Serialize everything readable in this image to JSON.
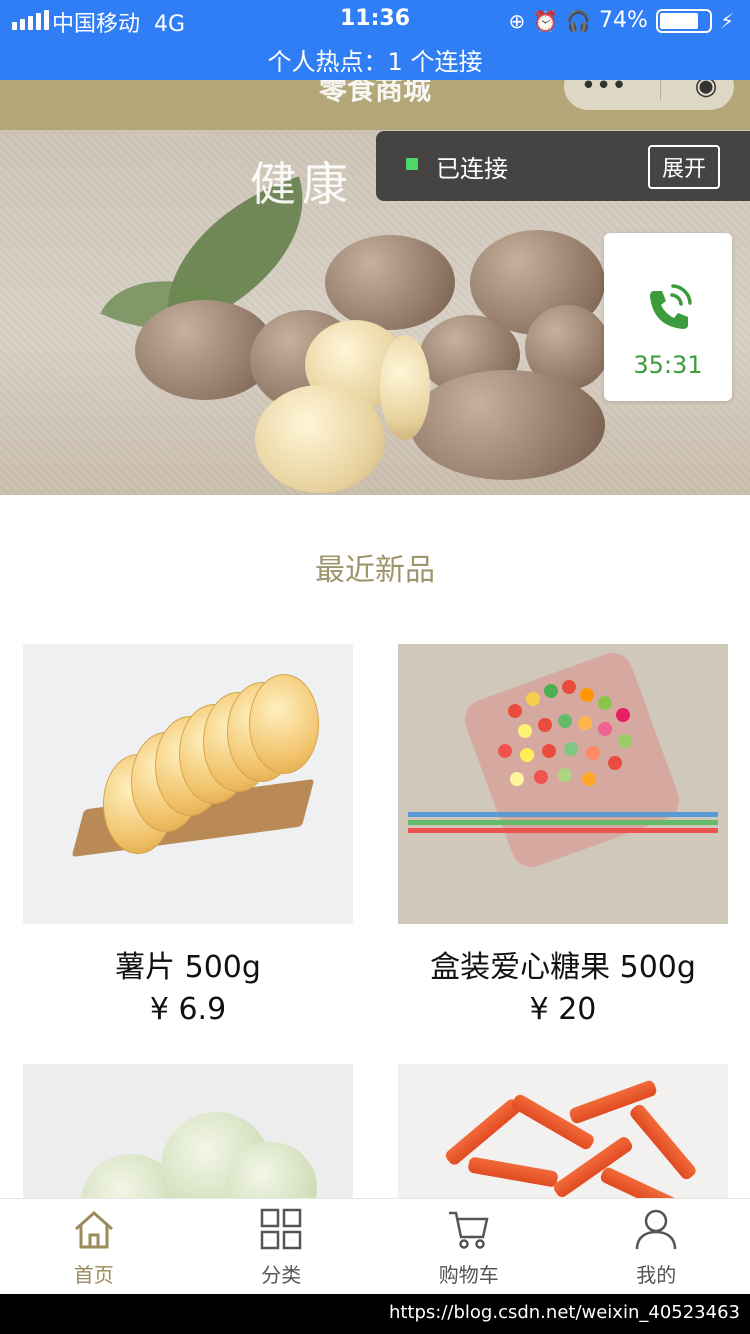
{
  "status_bar": {
    "carrier": "中国移动",
    "network": "4G",
    "time": "11:36",
    "battery_percent": "74%",
    "hotspot_text": "个人热点：1 个连接",
    "icons": [
      "signal-icon",
      "lock-rotation-icon",
      "alarm-icon",
      "headphones-icon",
      "battery-icon",
      "charging-icon"
    ],
    "bar_color": "#2f7ef6"
  },
  "mini_program": {
    "title": "零食商城",
    "capsule_icons": [
      "more-icon",
      "close-icon"
    ]
  },
  "hero": {
    "decor_text": "健康"
  },
  "overlay": {
    "connected_text": "已连接",
    "expand_label": "展开"
  },
  "call_widget": {
    "icon": "phone-call-icon",
    "duration": "35:31",
    "color": "#3c9b3c"
  },
  "section": {
    "title": "最近新品",
    "title_color": "#9d966d"
  },
  "products": [
    {
      "name": "薯片 500g",
      "price": "¥ 6.9"
    },
    {
      "name": "盒装爱心糖果 500g",
      "price": "¥ 20"
    },
    {
      "name": "",
      "price": ""
    },
    {
      "name": "",
      "price": ""
    }
  ],
  "tabbar": {
    "items": [
      {
        "label": "首页",
        "icon": "home-icon",
        "active": true
      },
      {
        "label": "分类",
        "icon": "grid-icon",
        "active": false
      },
      {
        "label": "购物车",
        "icon": "cart-icon",
        "active": false
      },
      {
        "label": "我的",
        "icon": "user-icon",
        "active": false
      }
    ],
    "active_color": "#9b8b5a"
  },
  "watermark": "https://blog.csdn.net/weixin_40523463"
}
